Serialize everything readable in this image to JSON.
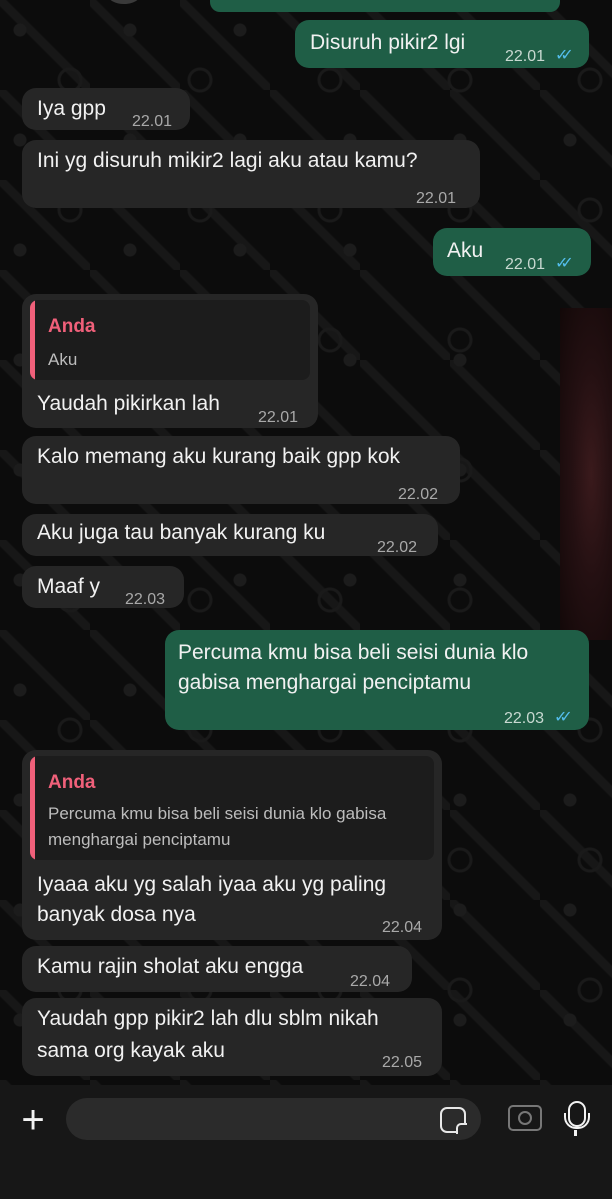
{
  "messages": [
    {
      "dir": "out",
      "text": "Disuruh pikir2 lgi",
      "time": "22.01"
    },
    {
      "dir": "in",
      "text": "Iya gpp",
      "time": "22.01"
    },
    {
      "dir": "in",
      "text": "Ini yg disuruh mikir2 lagi aku atau kamu?",
      "time": "22.01"
    },
    {
      "dir": "out",
      "text": "Aku",
      "time": "22.01"
    },
    {
      "dir": "in",
      "quote_name": "Anda",
      "quote_text": "Aku",
      "text": "Yaudah pikirkan lah",
      "time": "22.01"
    },
    {
      "dir": "in",
      "text": "Kalo memang aku kurang baik gpp kok",
      "time": "22.02"
    },
    {
      "dir": "in",
      "text": "Aku juga tau banyak kurang ku",
      "time": "22.02"
    },
    {
      "dir": "in",
      "text": "Maaf y",
      "time": "22.03"
    },
    {
      "dir": "out",
      "text_line1": "Percuma kmu bisa beli seisi dunia klo",
      "text_line2": "gabisa menghargai penciptamu",
      "time": "22.03"
    },
    {
      "dir": "in",
      "quote_name": "Anda",
      "quote_line1": "Percuma kmu bisa beli seisi dunia klo gabisa",
      "quote_line2": "menghargai penciptamu",
      "text_line1": "Iyaaa aku yg salah iyaa aku yg paling",
      "text_line2": "banyak dosa nya",
      "time": "22.04"
    },
    {
      "dir": "in",
      "text": "Kamu rajin sholat aku engga",
      "time": "22.04"
    },
    {
      "dir": "in",
      "text_line1": "Yaudah gpp pikir2 lah dlu sblm nikah",
      "text_line2": "sama org kayak aku",
      "time": "22.05"
    }
  ],
  "read_tick": "✓✓",
  "colors": {
    "outgoing": "#1f5e46",
    "incoming": "#262626",
    "quote_accent": "#f0607a",
    "tick": "#53bdeb"
  },
  "input_bar": {
    "icons": [
      "plus-icon",
      "sticker-icon",
      "camera-icon",
      "mic-icon"
    ],
    "input_value": ""
  }
}
